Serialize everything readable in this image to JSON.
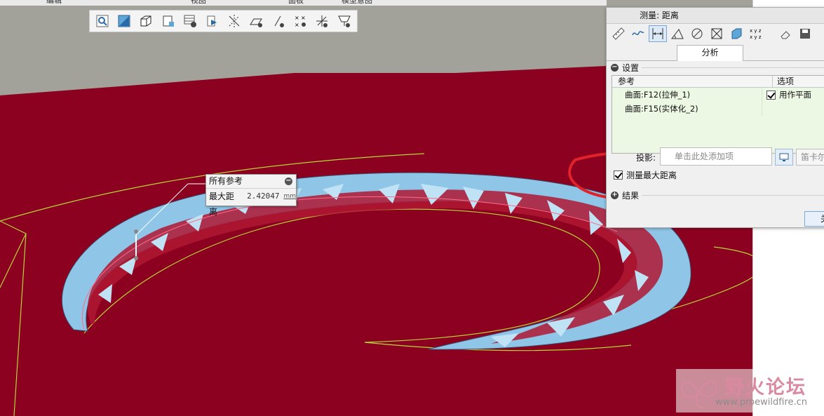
{
  "top_menu": [
    "编辑",
    "视图",
    "面板",
    "模型意图"
  ],
  "toolbar": {
    "icons": [
      "zoom-icon",
      "refit-icon",
      "view-orientation-icon",
      "saved-views-icon",
      "appearance-icon",
      "datum-plane-display-icon",
      "axis-display-icon",
      "plane-display-icon",
      "point-display-icon",
      "coordinate-system-display-icon",
      "csys-display-icon",
      "annotation-display-icon"
    ]
  },
  "callout": {
    "title": "所有参考",
    "label": "最大距离",
    "value": "2.42047",
    "unit": "mm"
  },
  "dialog": {
    "title": "测量: 距离",
    "tab": "分析",
    "settings_label": "设置",
    "table": {
      "col_ref": "参考",
      "col_option": "选项",
      "rows": [
        {
          "ref": "曲面:F12(拉伸_1)",
          "option": "用作平面",
          "checked": true
        },
        {
          "ref": "曲面:F15(实体化_2)",
          "option": ""
        }
      ]
    },
    "projection_label": "投影:",
    "projection_placeholder": "单击此处添加项",
    "coord_label": "笛卡尔",
    "max_distance_label": "测量最大距离",
    "max_distance_checked": true,
    "results_label": "结果",
    "close_label": "关"
  },
  "watermark": {
    "text": "野火论坛",
    "url": "www.proewildfire.cn"
  },
  "colors": {
    "model_red": "#8c0020",
    "annotation_circle": "#e0222a",
    "ring_blue": "#8fc6e8"
  }
}
